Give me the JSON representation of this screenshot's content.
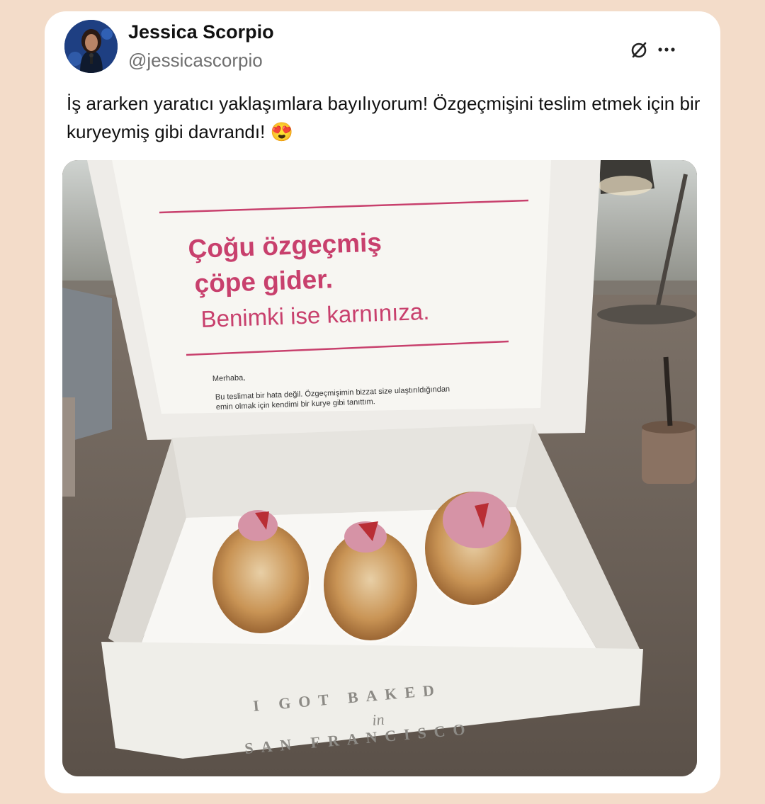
{
  "post": {
    "author_name": "Jessica Scorpio",
    "author_handle": "@jessicascorpio",
    "text": "İş ararken yaratıcı yaklaşımlara bayılıyorum! Özgeçmişini teslim etmek için bir kuryeymiş gibi davrandı! 😍"
  },
  "icons": {
    "no_entry": "slash-circle-icon",
    "more": "more-dots-icon"
  },
  "photo": {
    "headline_line1": "Çoğu özgeçmiş",
    "headline_line2": "çöpe gider.",
    "headline_line3": "Benimki ise karnınıza.",
    "note_greeting": "Merhaba,",
    "note_line1": "Bu teslimat bir hata değil. Özgeçmişimin bizzat size ulaştırıldığından",
    "note_line2": "emin olmak için kendimi bir kurye gibi tanıttım.",
    "box_brand_line1": "I GOT BAKED",
    "box_brand_line2": "in",
    "box_brand_line3": "SAN FRANCISCO"
  },
  "colors": {
    "page_bg": "#f3dcc9",
    "card_bg": "#ffffff",
    "accent_pink": "#c8406d"
  }
}
